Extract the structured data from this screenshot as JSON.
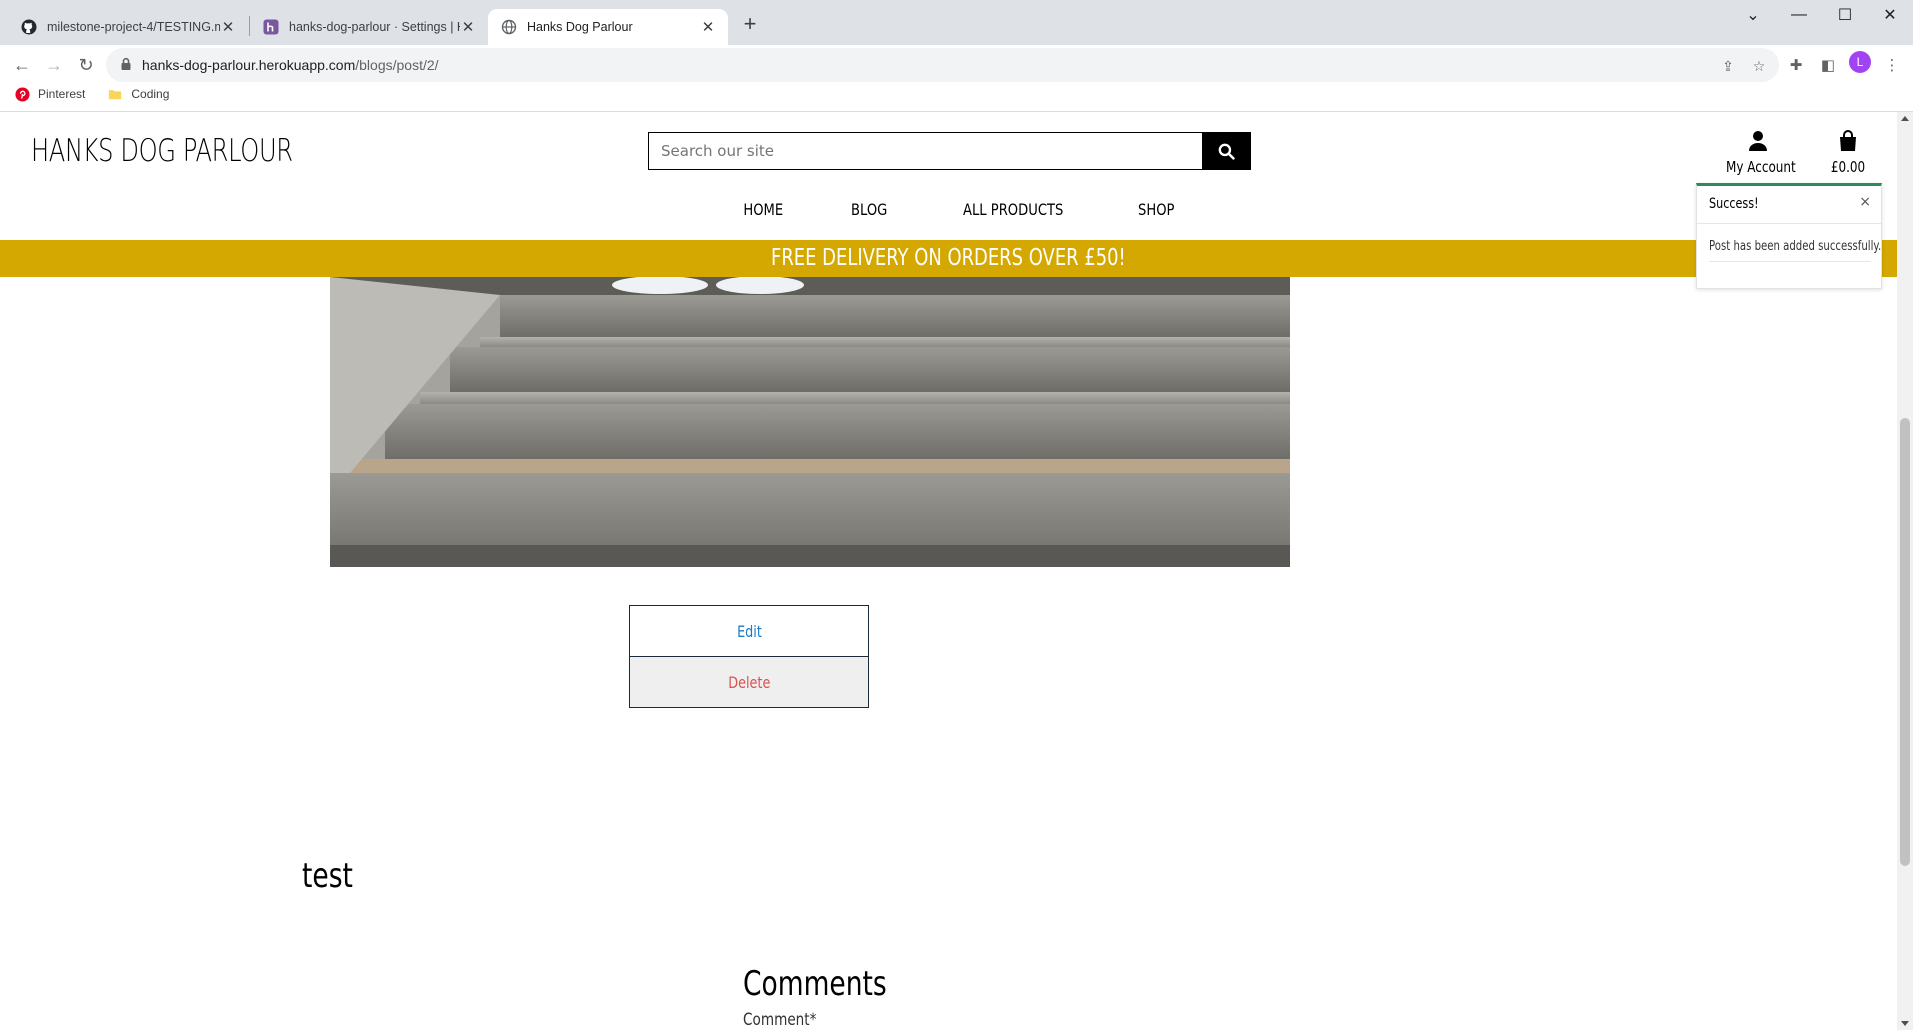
{
  "browser": {
    "tabs": [
      {
        "title": "milestone-project-4/TESTING.md",
        "icon": "github-icon",
        "active": false
      },
      {
        "title": "hanks-dog-parlour · Settings | He",
        "icon": "heroku-icon",
        "active": false
      },
      {
        "title": "Hanks Dog Parlour",
        "icon": "globe-icon",
        "active": true
      }
    ],
    "new_tab_label": "+",
    "address": {
      "host": "hanks-dog-parlour.herokuapp.com",
      "path": "/blogs/post/2/"
    },
    "bookmarks": [
      {
        "label": "Pinterest",
        "icon": "pinterest-icon"
      },
      {
        "label": "Coding",
        "icon": "folder-icon"
      }
    ],
    "profile_initial": "L",
    "colors": {
      "profile": "#a142f4"
    }
  },
  "site": {
    "brand": "HANKS DOG PARLOUR",
    "search": {
      "placeholder": "Search our site"
    },
    "account_label": "My Account",
    "bag_total": "£0.00",
    "nav": [
      "HOME",
      "BLOG",
      "ALL PRODUCTS",
      "SHOP"
    ],
    "banner": "FREE DELIVERY ON ORDERS OVER £50!",
    "colors": {
      "banner": "#d4a800",
      "edit_text": "#1e7bc4",
      "delete_text": "#d9534f",
      "toast_accent": "#2e8b57"
    }
  },
  "post": {
    "edit_label": "Edit",
    "delete_label": "Delete",
    "body": "test"
  },
  "comments": {
    "heading": "Comments",
    "field_label": "Comment*"
  },
  "toast": {
    "title": "Success!",
    "close": "×",
    "message": "Post has been added successfully."
  }
}
